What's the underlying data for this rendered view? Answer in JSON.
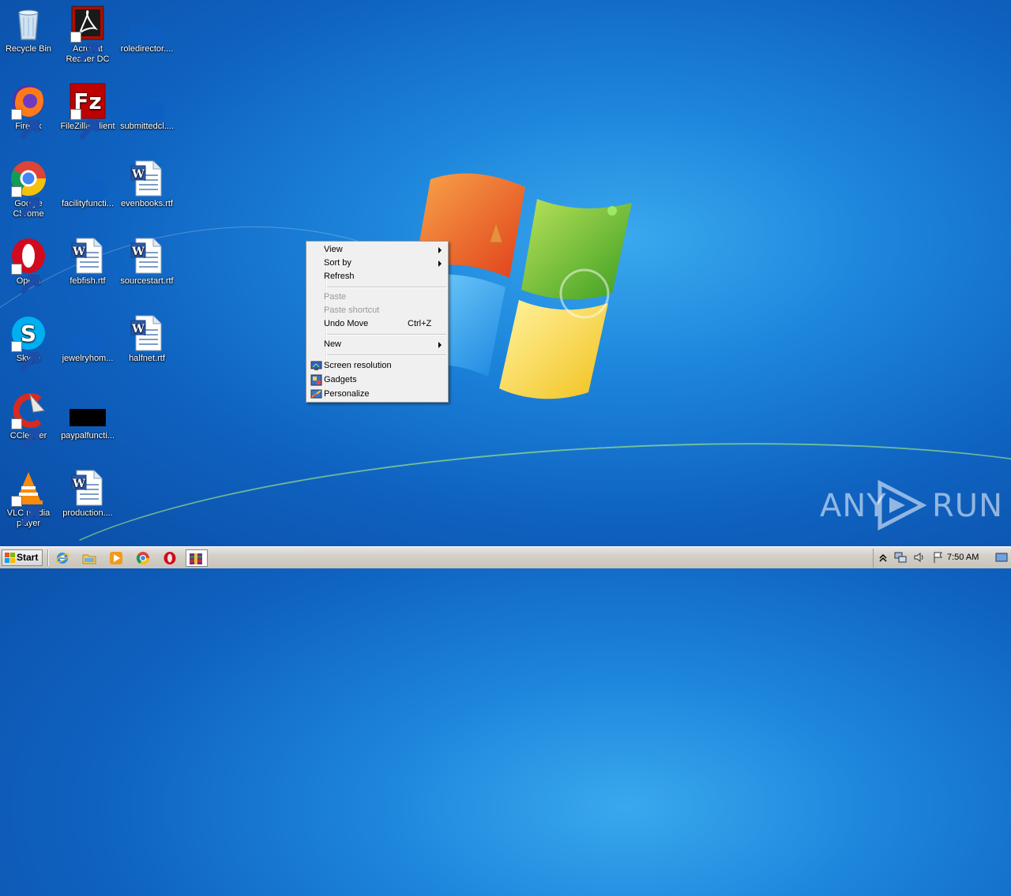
{
  "desktop": {
    "icons": [
      {
        "label": "Recycle Bin",
        "icon": "recycle-bin-icon"
      },
      {
        "label": "Acrobat Reader DC",
        "icon": "acrobat-reader-icon"
      },
      {
        "label": "roledirector....",
        "icon": "blank-file-icon"
      },
      {
        "label": "Firefox",
        "icon": "firefox-icon"
      },
      {
        "label": "FileZilla Client",
        "icon": "filezilla-icon"
      },
      {
        "label": "submittedcl....",
        "icon": "blank-file-icon"
      },
      {
        "label": "Google Chrome",
        "icon": "chrome-icon"
      },
      {
        "label": "facilityfuncti...",
        "icon": "blank-file-icon"
      },
      {
        "label": "evenbooks.rtf",
        "icon": "word-document-icon"
      },
      {
        "label": "Opera",
        "icon": "opera-icon"
      },
      {
        "label": "febfish.rtf",
        "icon": "word-document-icon"
      },
      {
        "label": "sourcestart.rtf",
        "icon": "word-document-icon"
      },
      {
        "label": "Skype",
        "icon": "skype-icon"
      },
      {
        "label": "jewelryhom...",
        "icon": "blank-file-icon"
      },
      {
        "label": "halfnet.rtf",
        "icon": "word-document-icon"
      },
      {
        "label": "CCleaner",
        "icon": "ccleaner-icon"
      },
      {
        "label": "paypalfuncti...",
        "icon": "black-file-icon"
      },
      {
        "label": "VLC media player",
        "icon": "vlc-icon"
      },
      {
        "label": "production....",
        "icon": "word-document-icon"
      }
    ]
  },
  "context_menu": {
    "view": "View",
    "sort_by": "Sort by",
    "refresh": "Refresh",
    "paste": "Paste",
    "paste_shortcut": "Paste shortcut",
    "undo_move": "Undo Move",
    "undo_move_shortcut": "Ctrl+Z",
    "new": "New",
    "screen_resolution": "Screen resolution",
    "gadgets": "Gadgets",
    "personalize": "Personalize"
  },
  "taskbar": {
    "start_label": "Start",
    "pinned": [
      "internet-explorer-icon",
      "windows-explorer-icon",
      "media-player-icon",
      "chrome-icon",
      "opera-icon",
      "winrar-icon"
    ],
    "clock": "7:50 AM"
  },
  "watermark": {
    "left": "ANY",
    "right": "RUN"
  }
}
